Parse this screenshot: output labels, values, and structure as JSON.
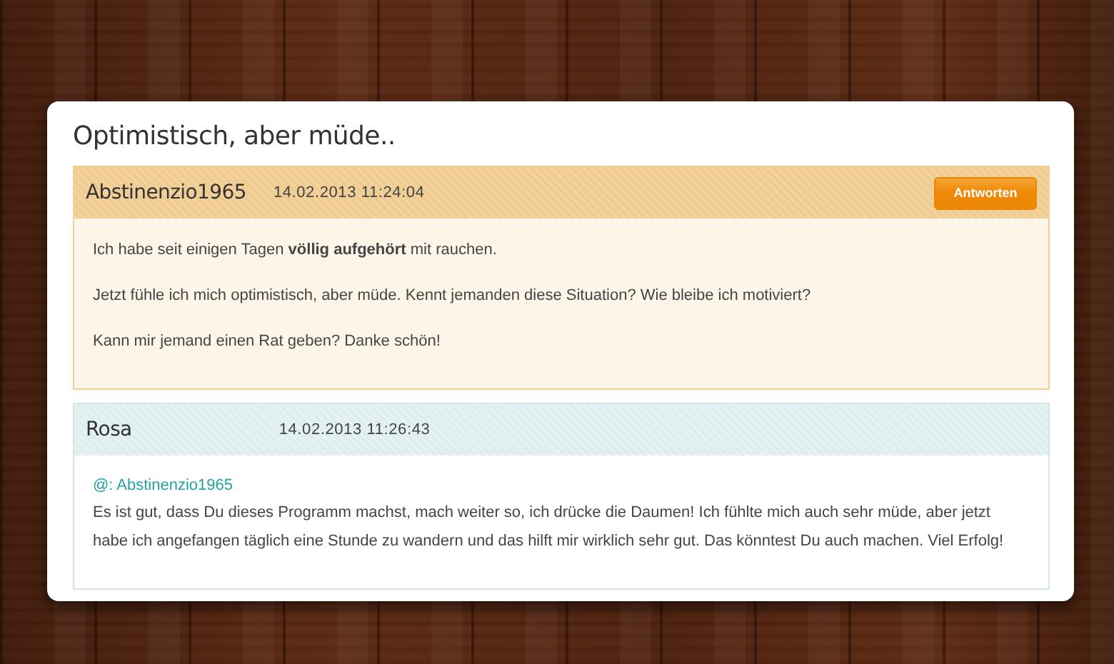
{
  "thread": {
    "title": "Optimistisch, aber müde..",
    "posts": [
      {
        "kind": "question",
        "author": "Abstinenzio1965",
        "timestamp": "14.02.2013 11:24:04",
        "reply_button": "Antworten",
        "paragraphs": [
          "Ich habe seit einigen Tagen **völlig aufgehört** mit rauchen.",
          "Jetzt fühle ich mich optimistisch, aber müde. Kennt jemanden diese Situation? Wie bleibe ich motiviert?",
          "Kann mir jemand einen Rat geben? Danke schön!"
        ]
      },
      {
        "kind": "reply",
        "author": "Rosa",
        "timestamp": "14.02.2013 11:26:43",
        "mention": "@: Abstinenzio1965",
        "paragraphs": [
          "Es ist gut, dass Du dieses Programm machst, mach weiter so, ich drücke die Daumen! Ich fühlte mich auch sehr müde, aber jetzt habe ich angefangen täglich eine Stunde zu wandern und das hilft mir wirklich sehr gut. Das könntest Du auch machen. Viel Erfolg!"
        ]
      }
    ]
  }
}
